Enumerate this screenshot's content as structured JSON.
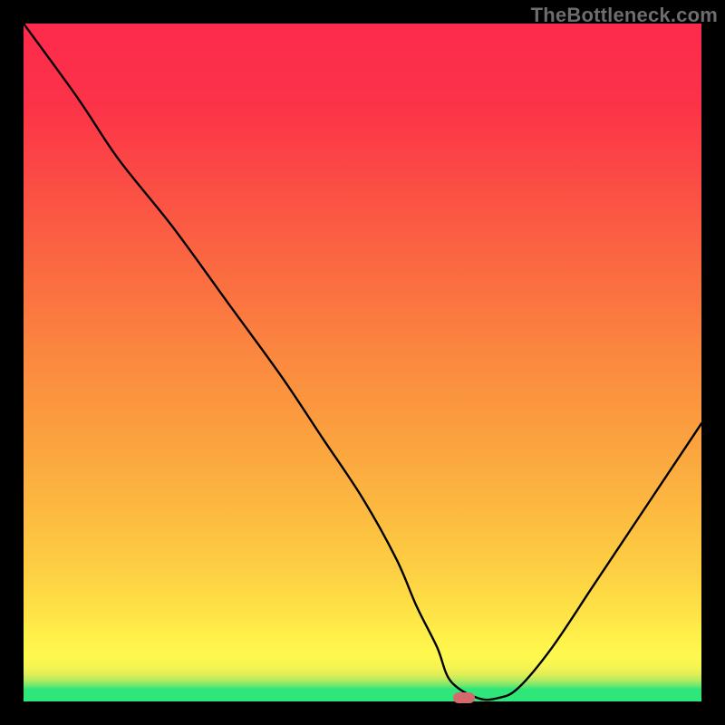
{
  "watermark": "TheBottleneck.com",
  "chart_data": {
    "type": "line",
    "title": "",
    "xlabel": "",
    "ylabel": "",
    "xlim": [
      0,
      100
    ],
    "ylim": [
      0,
      100
    ],
    "grid": false,
    "legend": false,
    "series": [
      {
        "name": "bottleneck-curve",
        "x": [
          0,
          8,
          14,
          22,
          30,
          38,
          44,
          50,
          55,
          58,
          61,
          63,
          67,
          70,
          73,
          78,
          84,
          90,
          96,
          100
        ],
        "y": [
          100,
          89,
          80,
          70,
          59,
          48,
          39,
          30,
          21,
          14,
          8,
          3,
          0.5,
          0.5,
          2,
          8,
          17,
          26,
          35,
          41
        ]
      }
    ],
    "marker": {
      "x": 65,
      "y": 0.6
    },
    "gradient_stops": [
      {
        "pct": 0,
        "color": "#2ee67a"
      },
      {
        "pct": 2,
        "color": "#2ee67a"
      },
      {
        "pct": 4,
        "color": "#e0ee56"
      },
      {
        "pct": 7,
        "color": "#fdf94e"
      },
      {
        "pct": 20,
        "color": "#fdd043"
      },
      {
        "pct": 50,
        "color": "#fb8a3f"
      },
      {
        "pct": 75,
        "color": "#fb5044"
      },
      {
        "pct": 100,
        "color": "#fd2a4c"
      }
    ]
  }
}
